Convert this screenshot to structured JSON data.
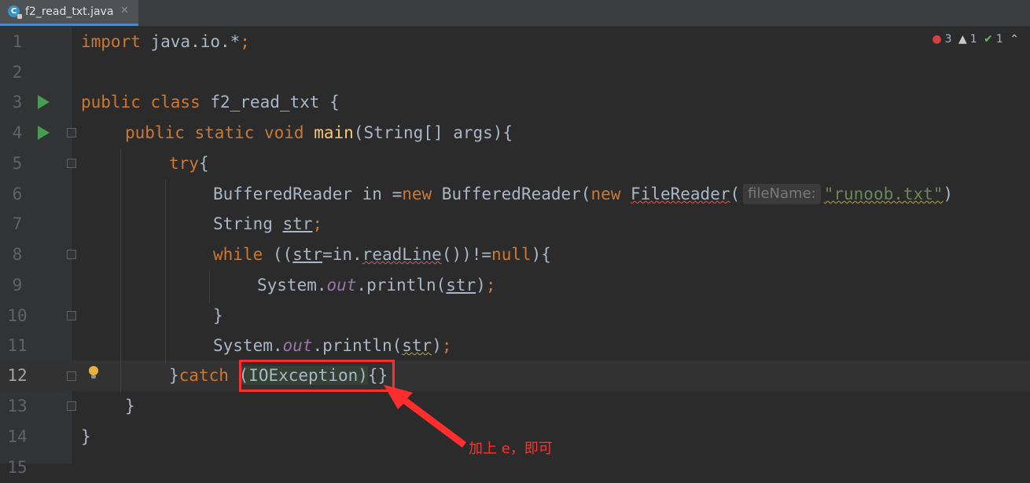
{
  "tab": {
    "filename": "f2_read_txt.java",
    "icon": "java-class-icon",
    "close_icon": "close-icon"
  },
  "indicators": {
    "errors": "3",
    "warnings": "1",
    "ok": "1"
  },
  "lines": [
    {
      "n": "1"
    },
    {
      "n": "2"
    },
    {
      "n": "3"
    },
    {
      "n": "4"
    },
    {
      "n": "5"
    },
    {
      "n": "6"
    },
    {
      "n": "7"
    },
    {
      "n": "8"
    },
    {
      "n": "9"
    },
    {
      "n": "10"
    },
    {
      "n": "11"
    },
    {
      "n": "12"
    },
    {
      "n": "13"
    },
    {
      "n": "14"
    },
    {
      "n": "15"
    }
  ],
  "code": {
    "l1_kw": "import",
    "l1_rest": " java.io.*",
    "l1_semi": ";",
    "l3_kw": "public class",
    "l3_rest": " f2_read_txt {",
    "l4_kw": "public static void",
    "l4_fn": " main",
    "l4_rest": "(String[] args){",
    "l5_kw": "try",
    "l5_rest": "{",
    "l6_a": "BufferedReader in =",
    "l6_new1": "new",
    "l6_b": " BufferedReader(",
    "l6_new2": "new",
    "l6_sp": " ",
    "l6_filereader": "FileReader",
    "l6_paren": "(",
    "l6_hint": "fileName:",
    "l6_str": "\"runoob.txt\"",
    "l6_end": ")",
    "l7_a": "String ",
    "l7_var": "str",
    "l7_semi": ";",
    "l8_kw": "while",
    "l8_a": " ((",
    "l8_var": "str",
    "l8_b": "=in.",
    "l8_readline": "readLine",
    "l8_c": "())!=",
    "l8_null": "null",
    "l8_d": "){",
    "l9_a": "System.",
    "l9_out": "out",
    "l9_b": ".println(",
    "l9_var": "str",
    "l9_c": ")",
    "l9_semi": ";",
    "l10": "}",
    "l11_a": "System.",
    "l11_out": "out",
    "l11_b": ".println(",
    "l11_var": "str",
    "l11_c": ")",
    "l11_semi": ";",
    "l12_a": "}",
    "l12_catch": "catch",
    "l12_sp": " ",
    "l12_exc": "(IOException)",
    "l12_b": "{}",
    "l13": "}",
    "l14": "}"
  },
  "annotation": {
    "text": "加上 e，即可"
  },
  "colors": {
    "background": "#2b2b2b",
    "keyword": "#cc7832",
    "string": "#6a8759",
    "function": "#ffc66d",
    "static_field": "#9876aa",
    "annotation_red": "#ff2e2e"
  }
}
